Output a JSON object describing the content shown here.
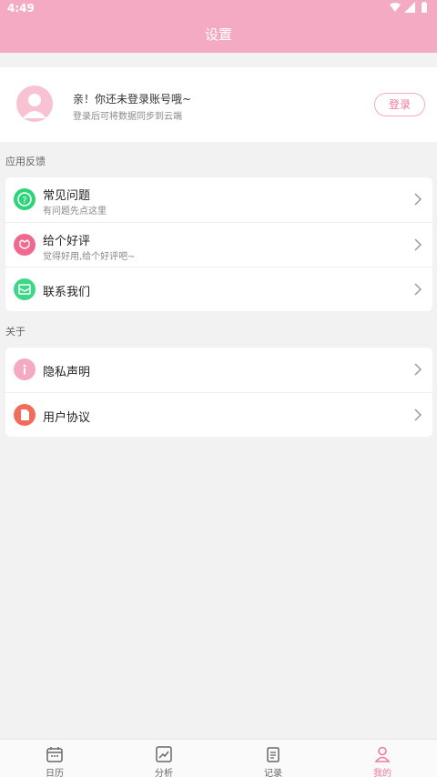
{
  "statusbar": {
    "time": "4:49"
  },
  "header": {
    "title": "设置"
  },
  "profile": {
    "title": "亲！你还未登录账号哦~",
    "subtitle": "登录后可将数据同步到云端",
    "login_label": "登录"
  },
  "sections": {
    "feedback_label": "应用反馈",
    "about_label": "关于"
  },
  "feedback_items": [
    {
      "title": "常见问题",
      "subtitle": "有问题先点这里",
      "icon": "question-icon",
      "color": "#2ed47a"
    },
    {
      "title": "给个好评",
      "subtitle": "觉得好用,给个好评吧~",
      "icon": "flower-icon",
      "color": "#f06a8f"
    },
    {
      "title": "联系我们",
      "icon": "mail-icon",
      "color": "#3ed688"
    }
  ],
  "about_items": [
    {
      "title": "隐私声明",
      "icon": "info-icon",
      "color": "#f4aac3"
    },
    {
      "title": "用户协议",
      "icon": "document-icon",
      "color": "#f26b5b"
    }
  ],
  "bottom_nav": [
    {
      "label": "日历",
      "icon": "calendar-icon",
      "active": false
    },
    {
      "label": "分析",
      "icon": "chart-icon",
      "active": false
    },
    {
      "label": "记录",
      "icon": "notes-icon",
      "active": false
    },
    {
      "label": "我的",
      "icon": "user-icon",
      "active": true
    }
  ],
  "colors": {
    "accent": "#f4aac3",
    "accent_text": "#f07aa0",
    "background": "#f2f2f2"
  }
}
